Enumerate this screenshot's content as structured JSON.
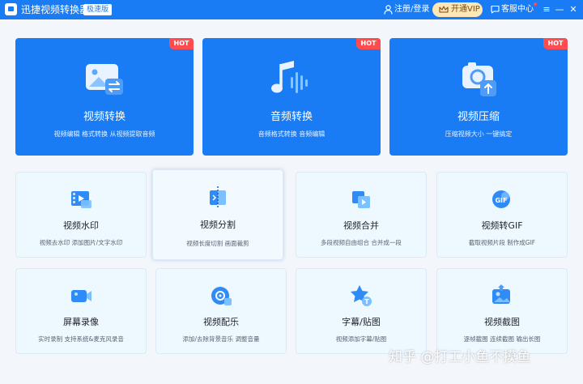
{
  "titlebar": {
    "app_title": "迅捷视频转换器",
    "edition": "极速版",
    "login": "注册/登录",
    "vip": "开通VIP",
    "service": "客服中心",
    "menu": "≡",
    "minimize": "—",
    "close": "✕",
    "accent_color": "#1a7cf5"
  },
  "big_cards": [
    {
      "title": "视频转换",
      "desc": "视频编辑 格式转换 从视频提取音频",
      "badge": "HOT",
      "icon": "video-convert-icon"
    },
    {
      "title": "音频转换",
      "desc": "音频格式转换 音频编辑",
      "badge": "HOT",
      "icon": "audio-convert-icon"
    },
    {
      "title": "视频压缩",
      "desc": "压缩视频大小 一键搞定",
      "badge": "HOT",
      "icon": "video-compress-icon"
    }
  ],
  "small_cards": [
    {
      "title": "视频水印",
      "desc": "视频去水印 添加图片/文字水印",
      "icon": "watermark-icon"
    },
    {
      "title": "视频分割",
      "desc": "视频长度切割 画面裁剪",
      "icon": "split-icon"
    },
    {
      "title": "视频合并",
      "desc": "多段视频自由组合 合并成一段",
      "icon": "merge-icon"
    },
    {
      "title": "视频转GIF",
      "desc": "截取视频片段 制作成GIF",
      "icon": "gif-icon"
    },
    {
      "title": "屏幕录像",
      "desc": "实时录制 支持系统&麦克风录音",
      "icon": "screen-record-icon"
    },
    {
      "title": "视频配乐",
      "desc": "添加/去除背景音乐 调整音量",
      "icon": "music-icon"
    },
    {
      "title": "字幕/贴图",
      "desc": "视频添加字幕/贴图",
      "icon": "subtitle-icon"
    },
    {
      "title": "视频截图",
      "desc": "逐帧截图 连续截图 输出长图",
      "icon": "screenshot-icon"
    }
  ],
  "watermark": "知乎 @打工小鱼不摸鱼"
}
